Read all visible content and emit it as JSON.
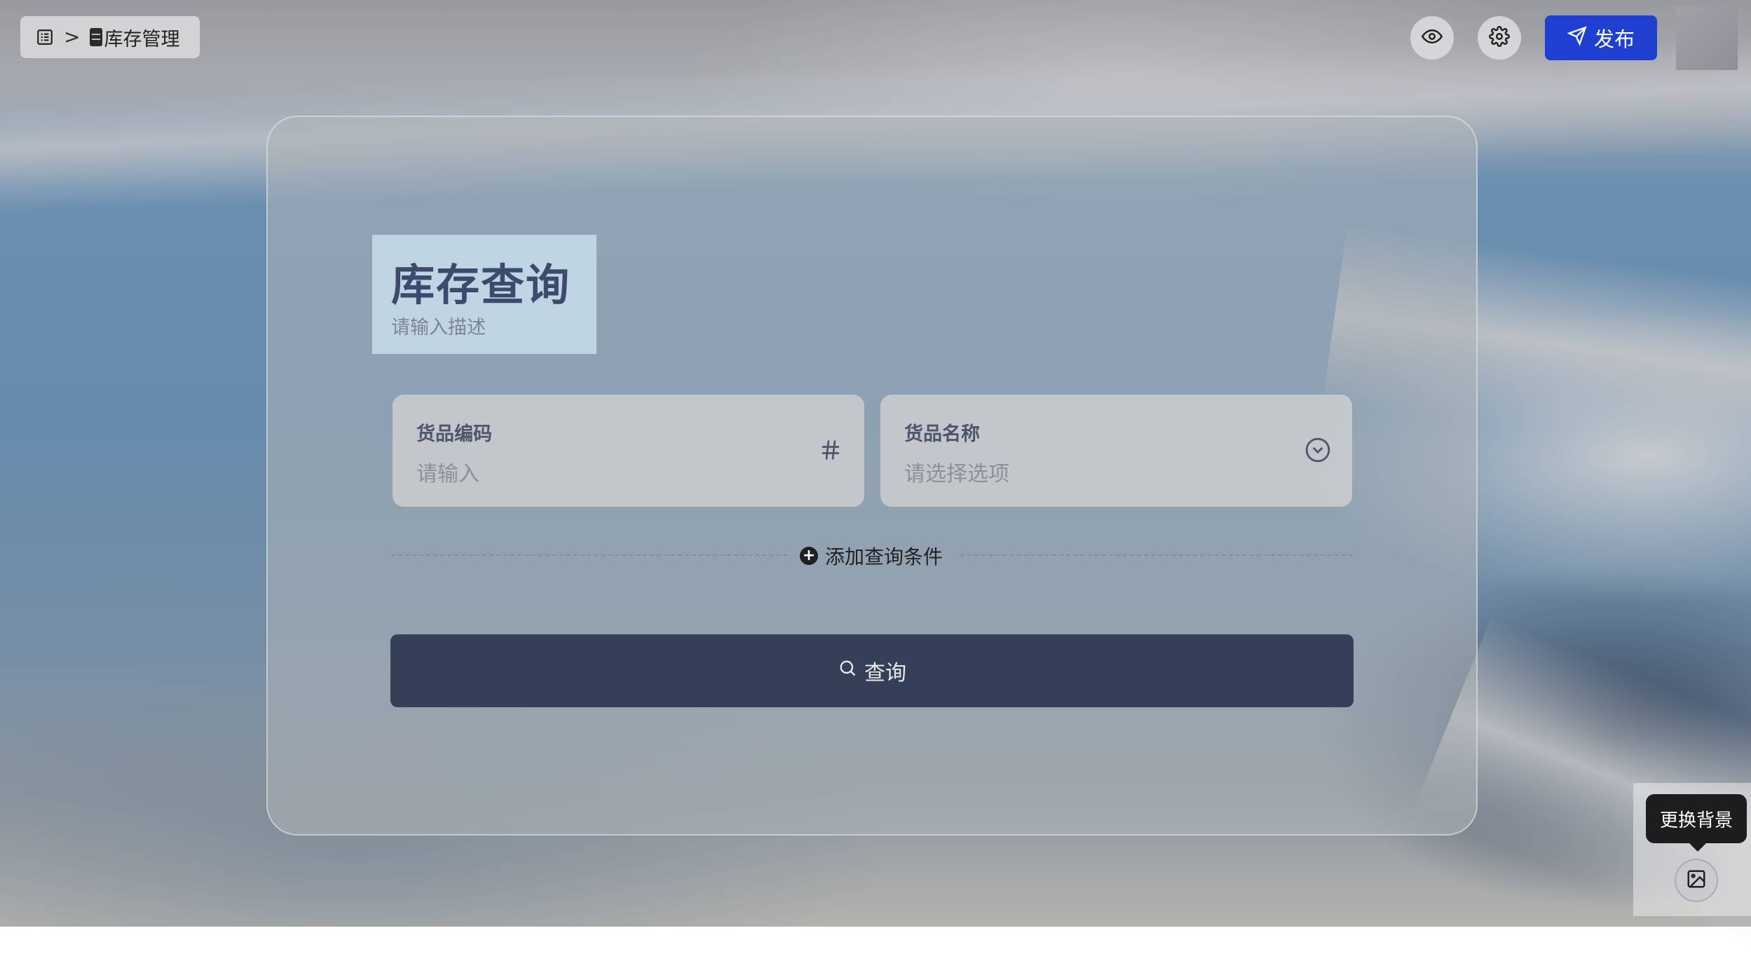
{
  "breadcrumb": {
    "sep": ">",
    "title": "库存管理"
  },
  "toolbar": {
    "publish_label": "发布"
  },
  "form": {
    "title": "库存查询",
    "description_placeholder": "请输入描述",
    "fields": [
      {
        "label": "货品编码",
        "placeholder": "请输入",
        "icon": "hash-icon"
      },
      {
        "label": "货品名称",
        "placeholder": "请选择选项",
        "icon": "chevron-down-circle-icon"
      }
    ],
    "add_condition_label": "添加查询条件",
    "query_label": "查询"
  },
  "background": {
    "tooltip": "更换背景"
  },
  "colors": {
    "primary": "#1f3fd0",
    "query_button": "#353f58",
    "title": "#3d4a6e"
  }
}
